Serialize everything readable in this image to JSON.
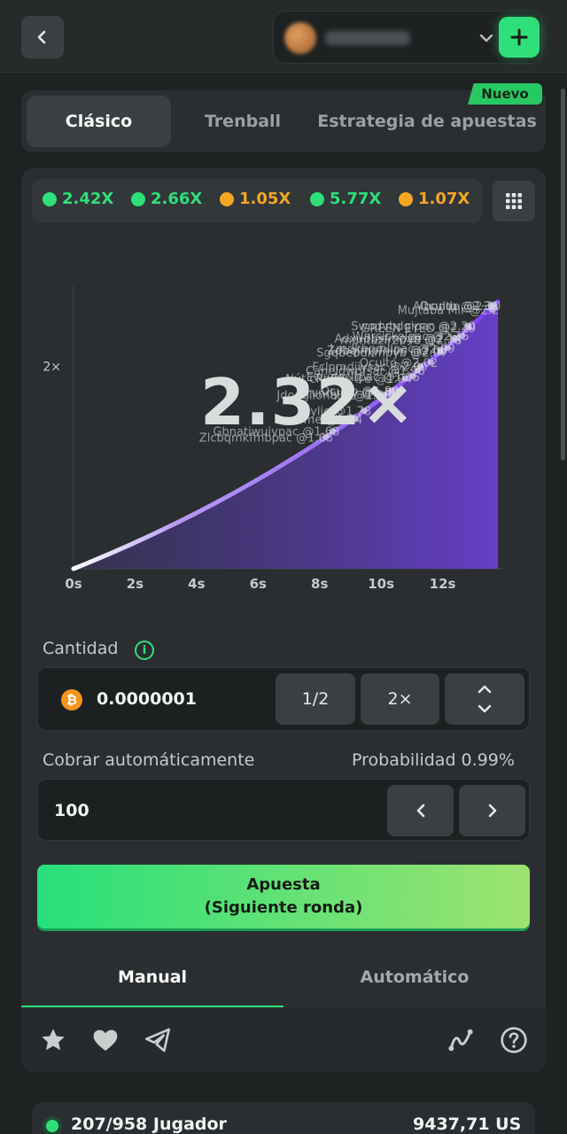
{
  "header": {
    "back_icon": "chevron-left-icon",
    "balance_text": "0,00 US$",
    "add_icon": "plus-icon",
    "accent": "#2fe07a"
  },
  "modes": {
    "tabs": [
      {
        "label": "Clásico",
        "active": true
      },
      {
        "label": "Trenball",
        "active": false
      },
      {
        "label": "Estrategia de apuestas",
        "active": false
      }
    ],
    "new_badge": "Nuevo"
  },
  "history": [
    {
      "value": "2.42X",
      "color": "#2fe07a"
    },
    {
      "value": "2.66X",
      "color": "#2fe07a"
    },
    {
      "value": "1.05X",
      "color": "#f5a623"
    },
    {
      "value": "5.77X",
      "color": "#2fe07a"
    },
    {
      "value": "1.07X",
      "color": "#f5a623"
    }
  ],
  "chart_data": {
    "type": "area",
    "multiplier_text": "2.32×",
    "y_tick_label": "2×",
    "x_ticks": [
      "0s",
      "2s",
      "4s",
      "6s",
      "8s",
      "10s",
      "12s"
    ],
    "x_range": [
      0,
      14
    ],
    "y_range": [
      1,
      2.4
    ],
    "curve": {
      "end_time": 13.8,
      "end_value": 2.32
    },
    "players": [
      {
        "label": "Oculto @2.30",
        "value": 2.3
      },
      {
        "label": "Albondo @2.30",
        "value": 2.3
      },
      {
        "label": "Mujtaba Mir @2.2",
        "value": 2.28
      },
      {
        "label": "Swodvbdgipac @2.20",
        "value": 2.2
      },
      {
        "label": "GREEN EYED @2.19",
        "value": 2.19
      },
      {
        "label": "Wnrsickolqac @2.15",
        "value": 2.15
      },
      {
        "label": "Adxudbsfmpyb @2.14",
        "value": 2.14
      },
      {
        "label": "muntazir2048 @2.13",
        "value": 2.13
      },
      {
        "label": "Lmdkbnmlipac @2.09",
        "value": 2.09
      },
      {
        "label": "Zdbqlmpfnioc @2.08",
        "value": 2.08
      },
      {
        "label": "Sgqbebdkmpyb @2.07",
        "value": 2.07
      },
      {
        "label": "Oculto @2.02",
        "value": 2.02
      },
      {
        "label": "Fclnmdjiysac @2.00",
        "value": 2.0
      },
      {
        "label": "Caheldwdfsar @1.98",
        "value": 1.98
      },
      {
        "label": "Ewudocitpac @1.95",
        "value": 1.95
      },
      {
        "label": "Nút cRaCKe®e @1.94",
        "value": 1.94
      },
      {
        "label": "Oculto @1.88",
        "value": 1.88
      },
      {
        "label": "Srvnrlymy @1.87",
        "value": 1.87
      },
      {
        "label": "Jdodglionalix @1.86",
        "value": 1.86
      },
      {
        "label": "Dylio @1.78",
        "value": 1.78
      },
      {
        "label": "Lexome @1.74",
        "value": 1.74
      },
      {
        "label": "Gbnatiwuivpac @1.68",
        "value": 1.68
      },
      {
        "label": "Zlcbqmkfmbpac @1.65",
        "value": 1.65
      }
    ]
  },
  "bet": {
    "amount_label": "Cantidad",
    "info_icon": "info-icon",
    "currency_icon": "bitcoin-icon",
    "amount_value": "0.0000001",
    "half_label": "1/2",
    "double_label": "2×",
    "stepper_icon": "up-down-chevron-icon",
    "auto_cashout_label": "Cobrar automáticamente",
    "probability_label": "Probabilidad 0.99%",
    "auto_cashout_value": "100",
    "bet_button_line1": "Apuesta",
    "bet_button_line2": "(Siguiente ronda)"
  },
  "play_tabs": [
    {
      "label": "Manual",
      "active": true
    },
    {
      "label": "Automático",
      "active": false
    }
  ],
  "footer_icons": [
    "star-icon",
    "heart-icon",
    "send-icon",
    "trend-graph-icon",
    "help-icon"
  ],
  "players_summary": {
    "count_text": "207/958 Jugador",
    "total_text": "9437,71 US"
  }
}
